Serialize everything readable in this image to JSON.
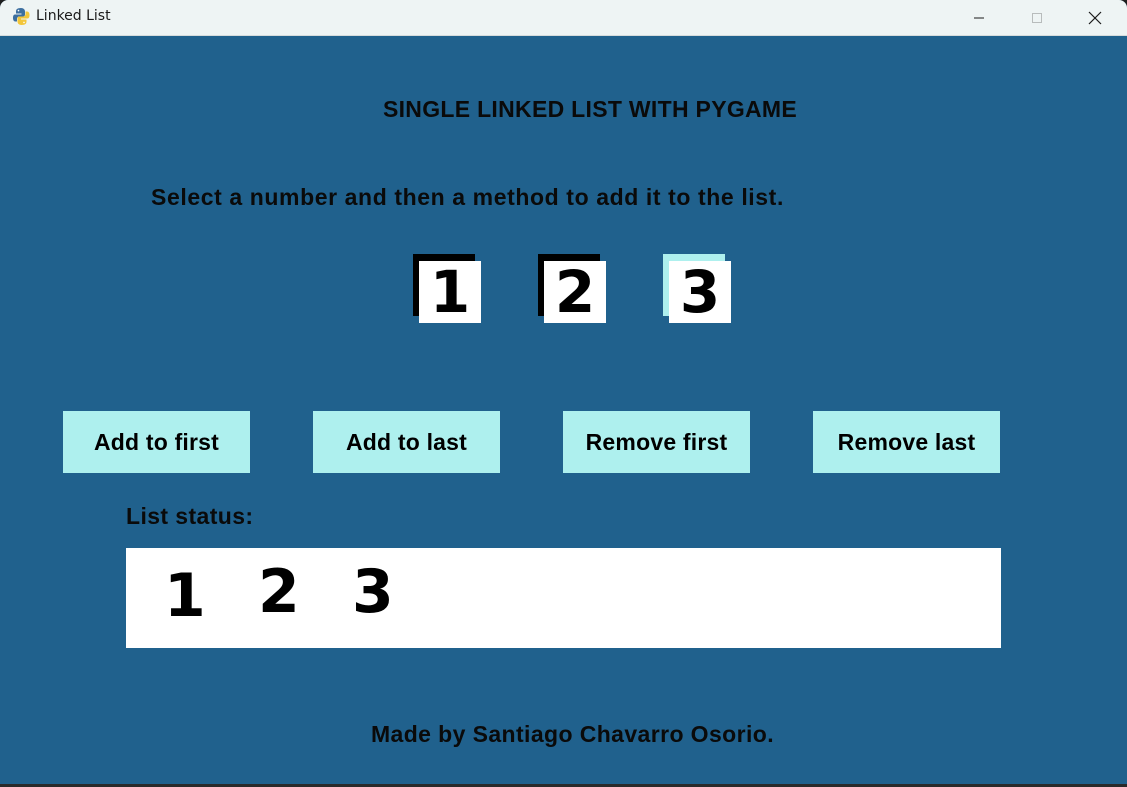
{
  "window": {
    "title": "Linked List",
    "background_color": "#20618d",
    "icon": "python-icon"
  },
  "titlebar_controls": {
    "minimize_icon": "minimize-icon",
    "maximize_icon": "maximize-icon",
    "close_icon": "close-icon"
  },
  "heading": "SINGLE LINKED LIST WITH PYGAME",
  "instruction": "Select a number and then a method to add it to the list.",
  "number_tiles": [
    {
      "label": "1",
      "selected": false
    },
    {
      "label": "2",
      "selected": false
    },
    {
      "label": "3",
      "selected": true
    }
  ],
  "actions": {
    "add_first": "Add to first",
    "add_last": "Add to last",
    "remove_first": "Remove first",
    "remove_last": "Remove last"
  },
  "status": {
    "label": "List status:",
    "items": [
      "1",
      "2",
      "3"
    ]
  },
  "footer": "Made by Santiago Chavarro Osorio.",
  "colors": {
    "button": "#aef0ee",
    "selected_tile_shadow": "#aef0ee",
    "text": "#0a0a0a",
    "panel": "#ffffff"
  }
}
